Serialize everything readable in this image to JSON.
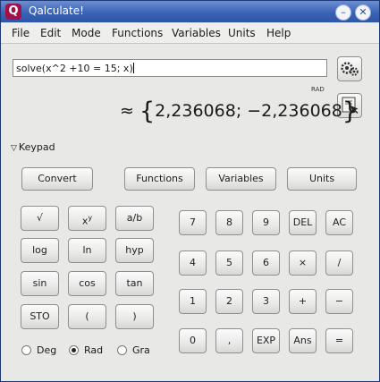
{
  "window": {
    "title": "Qalculate!",
    "app_icon": "Q"
  },
  "titlebar_buttons": [
    "–",
    "✕"
  ],
  "menu": {
    "file": "File",
    "edit": "Edit",
    "mode": "Mode",
    "functions": "Functions",
    "variables": "Variables",
    "units": "Units",
    "help": "Help"
  },
  "expression": {
    "text": "solve(x^2 +10 = 15; x)"
  },
  "angle_indicator": "RAD",
  "result": {
    "prefix": "≈",
    "open": "{",
    "value": "2,236068; −2,236068",
    "close": "}"
  },
  "keypad": {
    "label": "Keypad",
    "top_buttons": [
      "Convert",
      "Functions",
      "Variables",
      "Units"
    ],
    "left_rows": [
      [
        "√",
        "x",
        "a/b"
      ],
      [
        "log",
        "ln",
        "hyp"
      ],
      [
        "sin",
        "cos",
        "tan"
      ],
      [
        "STO",
        "(",
        ")"
      ]
    ],
    "xy_sup": "y",
    "right_rows": [
      [
        "7",
        "8",
        "9",
        "DEL",
        "AC"
      ],
      [
        "4",
        "5",
        "6",
        "×",
        "/"
      ],
      [
        "1",
        "2",
        "3",
        "+",
        "−"
      ],
      [
        "0",
        ",",
        "EXP",
        "Ans",
        "="
      ]
    ]
  },
  "angle_unit": {
    "deg": "Deg",
    "rad": "Rad",
    "gra": "Gra",
    "selected": "Rad"
  }
}
